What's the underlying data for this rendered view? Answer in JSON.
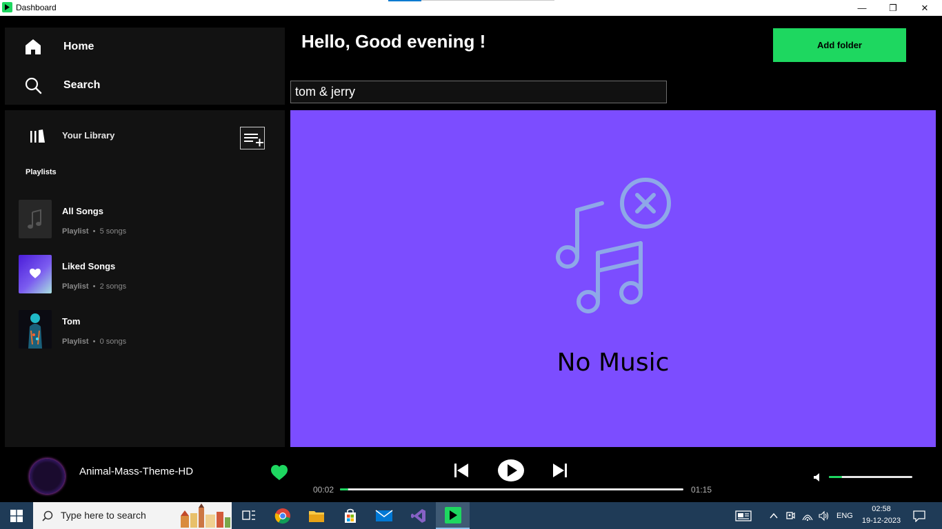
{
  "window": {
    "title": "Dashboard",
    "minimize_glyph": "—",
    "restore_glyph": "❐",
    "close_glyph": "✕"
  },
  "nav": {
    "home_label": "Home",
    "search_label": "Search"
  },
  "library": {
    "title": "Your Library",
    "playlists_heading": "Playlists",
    "playlists": [
      {
        "name": "All Songs",
        "type": "Playlist",
        "count": "5 songs"
      },
      {
        "name": "Liked Songs",
        "type": "Playlist",
        "count": "2 songs"
      },
      {
        "name": "Tom",
        "type": "Playlist",
        "count": "0 songs"
      }
    ]
  },
  "header": {
    "greeting": "Hello, Good evening !",
    "add_folder_label": "Add folder"
  },
  "search": {
    "value": "tom & jerry"
  },
  "content": {
    "empty_text": "No Music",
    "background_color": "#7c4dff"
  },
  "player": {
    "track_title": "Animal-Mass-Theme-HD",
    "elapsed": "00:02",
    "duration": "01:15",
    "progress": 0.024,
    "volume": 0.16,
    "liked": true,
    "accent_color": "#1ed760"
  },
  "taskbar": {
    "search_placeholder": "Type here to search",
    "language": "ENG",
    "time": "02:58",
    "date": "19-12-2023"
  }
}
